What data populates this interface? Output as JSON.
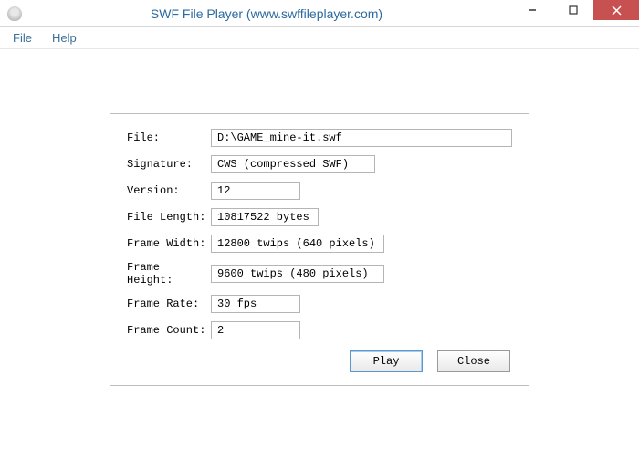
{
  "window": {
    "title": "SWF File Player (www.swffileplayer.com)"
  },
  "menu": {
    "file": "File",
    "help": "Help"
  },
  "labels": {
    "file": "File:",
    "signature": "Signature:",
    "version": "Version:",
    "file_length": "File Length:",
    "frame_width": "Frame Width:",
    "frame_height": "Frame Height:",
    "frame_rate": "Frame Rate:",
    "frame_count": "Frame Count:"
  },
  "values": {
    "file": "D:\\GAME_mine-it.swf",
    "signature": "CWS (compressed SWF)",
    "version": "12",
    "file_length": "10817522 bytes",
    "frame_width": "12800 twips (640 pixels)",
    "frame_height": "9600 twips (480 pixels)",
    "frame_rate": "30 fps",
    "frame_count": "2"
  },
  "buttons": {
    "play": "Play",
    "close": "Close"
  }
}
